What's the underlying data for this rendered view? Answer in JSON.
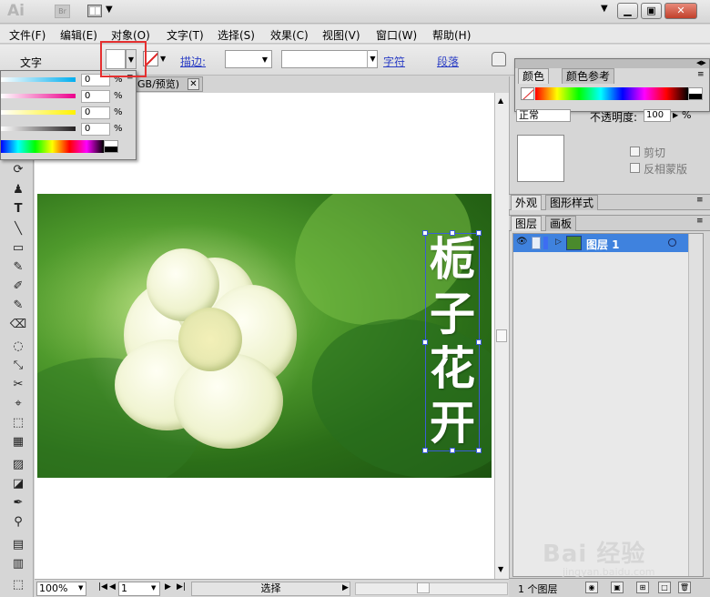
{
  "titlebar": {
    "app_logo": "Ai",
    "bridge_logo": "Br",
    "window_buttons": [
      "▁",
      "▣",
      "✕"
    ],
    "dropdown_caret": "▼"
  },
  "menubar": {
    "items": [
      "文件(F)",
      "编辑(E)",
      "对象(O)",
      "文字(T)",
      "选择(S)",
      "效果(C)",
      "视图(V)",
      "窗口(W)",
      "帮助(H)"
    ]
  },
  "controlbar": {
    "type_label": "文字",
    "stroke_label": "描边:",
    "character_link": "字符",
    "paragraph_link": "段落",
    "dropdown_caret": "▼",
    "highlight_color": "#e53030"
  },
  "color_popover": {
    "channels": [
      {
        "value": "0",
        "color": "#00aeef"
      },
      {
        "value": "0",
        "color": "#ec008c"
      },
      {
        "value": "0",
        "color": "#fff200"
      },
      {
        "value": "0",
        "color": "#231f20"
      }
    ],
    "unit": "%",
    "menu_icon": "≡"
  },
  "document": {
    "tab_title": "GB/预览)",
    "close_glyph": "✕"
  },
  "artwork": {
    "vertical_text": [
      "栀",
      "子",
      "花",
      "开"
    ],
    "selection_color": "#3a5dd8"
  },
  "statusbar": {
    "zoom": "100%",
    "page": "1",
    "status_text": "选择",
    "nav_first": "|◀",
    "nav_prev": "◀",
    "nav_next": "▶",
    "nav_last": "▶|",
    "caret": "▼",
    "status_arrow": "▶"
  },
  "color_panel": {
    "tabs": [
      "颜色",
      "颜色参考"
    ]
  },
  "transparency_panel": {
    "blend_mode": "正常",
    "opacity_label": "不透明度:",
    "opacity_value": "100",
    "opacity_unit": "%",
    "clip_label": "剪切",
    "invert_label": "反相蒙版"
  },
  "appearance_panel": {
    "tabs": [
      "外观",
      "图形样式"
    ]
  },
  "layers_panel": {
    "tabs": [
      "图层",
      "画板"
    ],
    "layer_name": "图层 1",
    "layer_count": "1 个图层",
    "accent": "#3f82de"
  },
  "watermark": {
    "logo_text": "Bai 经验",
    "sub_text": "jingyan.baidu.com"
  },
  "tools": {
    "icons": [
      "⟳",
      "♟",
      "T",
      "╲",
      "▭",
      "✎",
      "✐",
      "⌫",
      "◌",
      "⤡",
      "✂",
      "⌖",
      "⬚",
      "▦",
      "▨",
      "◪",
      "✒",
      "⚲",
      "▤",
      "▥"
    ]
  }
}
